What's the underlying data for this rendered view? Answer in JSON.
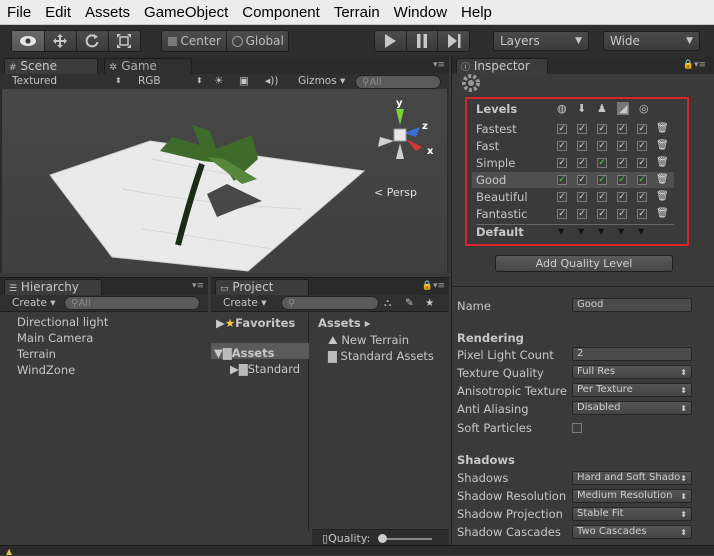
{
  "menu": [
    "File",
    "Edit",
    "Assets",
    "GameObject",
    "Component",
    "Terrain",
    "Window",
    "Help"
  ],
  "toolbar": {
    "pivot_label": "Center",
    "space_label": "Global",
    "layers_label": "Layers",
    "layout_label": "Wide"
  },
  "scene": {
    "tab_scene": "Scene",
    "tab_game": "Game",
    "shading": "Textured",
    "render_mode": "RGB",
    "gizmos": "Gizmos",
    "search_placeholder": "All",
    "persp_label": "Persp",
    "axis_x": "x",
    "axis_y": "y",
    "axis_z": "z"
  },
  "hierarchy": {
    "tab": "Hierarchy",
    "create": "Create",
    "search_placeholder": "All",
    "items": [
      "Directional light",
      "Main Camera",
      "Terrain",
      "WindZone"
    ]
  },
  "project": {
    "tab": "Project",
    "create": "Create",
    "favorites": "Favorites",
    "assets_root": "Assets",
    "assets_child": "Standard",
    "breadcrumb": "Assets",
    "files": [
      "New Terrain",
      "Standard Assets"
    ],
    "quality_label": "Quality:"
  },
  "inspector": {
    "tab": "Inspector",
    "levels_header": "Levels",
    "quality_levels": [
      {
        "name": "Fastest",
        "highlight": false,
        "green": [
          false,
          false,
          false,
          false,
          false
        ]
      },
      {
        "name": "Fast",
        "highlight": false,
        "green": [
          false,
          false,
          false,
          false,
          false
        ]
      },
      {
        "name": "Simple",
        "highlight": false,
        "green": [
          false,
          false,
          true,
          false,
          false
        ]
      },
      {
        "name": "Good",
        "highlight": true,
        "green": [
          true,
          false,
          true,
          true,
          true
        ]
      },
      {
        "name": "Beautiful",
        "highlight": false,
        "green": [
          false,
          false,
          false,
          false,
          false
        ]
      },
      {
        "name": "Fantastic",
        "highlight": false,
        "green": [
          false,
          false,
          false,
          false,
          false
        ]
      }
    ],
    "default_label": "Default",
    "add_button": "Add Quality Level",
    "name_label": "Name",
    "name_value": "Good",
    "rendering_header": "Rendering",
    "pixel_light_label": "Pixel Light Count",
    "pixel_light_value": "2",
    "texture_quality_label": "Texture Quality",
    "texture_quality_value": "Full Res",
    "aniso_label": "Anisotropic Texture",
    "aniso_value": "Per Texture",
    "aa_label": "Anti Aliasing",
    "aa_value": "Disabled",
    "soft_particles_label": "Soft Particles",
    "shadows_header": "Shadows",
    "shadows_label": "Shadows",
    "shadows_value": "Hard and Soft Shado",
    "shadow_res_label": "Shadow Resolution",
    "shadow_res_value": "Medium Resolution",
    "shadow_proj_label": "Shadow Projection",
    "shadow_proj_value": "Stable Fit",
    "shadow_cascades_label": "Shadow Cascades",
    "shadow_cascades_value": "Two Cascades"
  },
  "colors": {
    "highlight_box": "#d7262a",
    "check_green": "#47d84a",
    "axis_y": "#7fd03a",
    "axis_z": "#3a6fd8",
    "axis_x": "#d8362e"
  }
}
